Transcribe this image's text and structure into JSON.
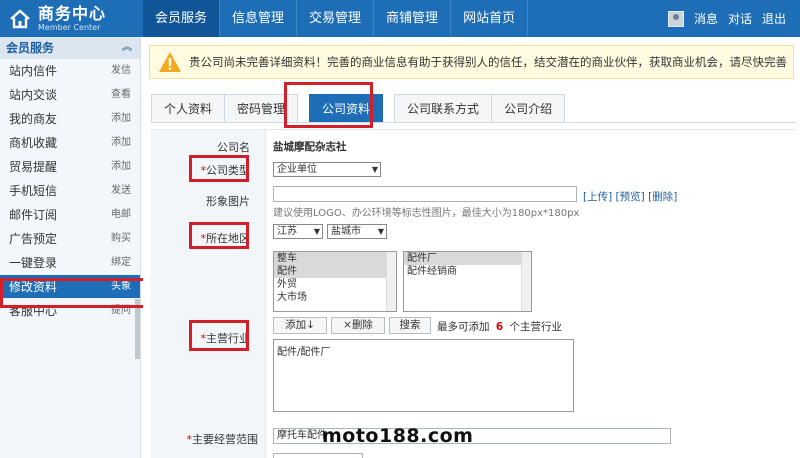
{
  "header": {
    "title": "商务中心",
    "subtitle": "Member Center",
    "nav": [
      "会员服务",
      "信息管理",
      "交易管理",
      "商铺管理",
      "网站首页"
    ],
    "right": {
      "messages": "消息",
      "chat": "对话",
      "logout": "退出"
    }
  },
  "sidebar": {
    "title": "会员服务",
    "items": [
      {
        "label": "站内信件",
        "action": "发信"
      },
      {
        "label": "站内交谈",
        "action": "查看"
      },
      {
        "label": "我的商友",
        "action": "添加"
      },
      {
        "label": "商机收藏",
        "action": "添加"
      },
      {
        "label": "贸易提醒",
        "action": "添加"
      },
      {
        "label": "手机短信",
        "action": "发送"
      },
      {
        "label": "邮件订阅",
        "action": "电邮"
      },
      {
        "label": "广告预定",
        "action": "购买"
      },
      {
        "label": "一键登录",
        "action": "绑定"
      },
      {
        "label": "修改资料",
        "action": "头象"
      },
      {
        "label": "客服中心",
        "action": "提问"
      }
    ]
  },
  "notice": "贵公司尚未完善详细资料！完善的商业信息有助于获得别人的信任，结交潜在的商业伙伴，获取商业机会，请尽快完善",
  "tabs": [
    "个人资料",
    "密码管理",
    "公司资料",
    "公司联系方式",
    "公司介绍"
  ],
  "form": {
    "company_name_label": "公司名",
    "company_name_value": "盐城摩配杂志社",
    "company_type_label": "公司类型",
    "company_type_value": "企业单位",
    "image_label": "形象图片",
    "image_links": {
      "upload": "[上传]",
      "preview": "[预览]",
      "delete": "[删除]"
    },
    "image_hint": "建议使用LOGO、办公环境等标志性图片，最佳大小为180px*180px",
    "region_label": "所在地区",
    "province": "江苏",
    "city": "盐城市",
    "industry_label": "主营行业",
    "industry_left": [
      "整车",
      "配件",
      "外贸",
      "大市场"
    ],
    "industry_right": [
      "配件厂",
      "配件经销商"
    ],
    "btn_add": "添加↓",
    "btn_delete": "×删除",
    "btn_search": "搜索",
    "max_prefix": "最多可添加",
    "max_count": "6",
    "max_suffix": "个主营行业",
    "selected_industry": "配件/配件厂",
    "scope_label": "主要经营范围",
    "scope_value": "摩托车配件"
  },
  "watermark": "moto188.com",
  "colors": {
    "brand": "#1d6eb6",
    "highlight": "#d21f2a",
    "required": "#dd0000"
  }
}
